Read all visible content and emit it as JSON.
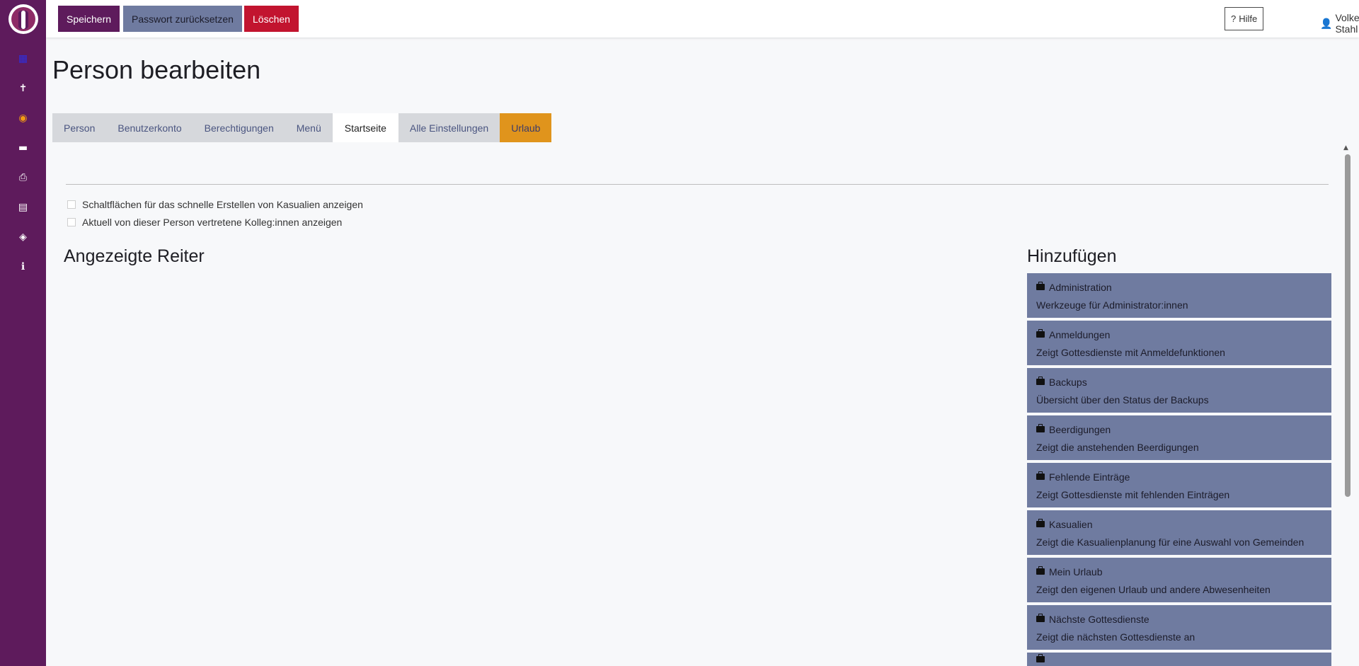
{
  "sidebar": {
    "icons": [
      {
        "name": "calendar-icon",
        "glyph": "▦"
      },
      {
        "name": "cross-icon",
        "glyph": "✝"
      },
      {
        "name": "globe-icon",
        "glyph": "◉"
      },
      {
        "name": "card-icon",
        "glyph": "▬"
      },
      {
        "name": "printer-icon",
        "glyph": "⎙"
      },
      {
        "name": "calendar-week-icon",
        "glyph": "▤"
      },
      {
        "name": "user-shield-icon",
        "glyph": "◈"
      },
      {
        "name": "info-icon",
        "glyph": "ℹ"
      }
    ]
  },
  "toolbar": {
    "save_label": "Speichern",
    "reset_password_label": "Passwort zurücksetzen",
    "delete_label": "Löschen",
    "help_label": "Hilfe",
    "user_name": "Volker Stahl"
  },
  "page": {
    "title": "Person bearbeiten"
  },
  "tabs": [
    {
      "label": "Person"
    },
    {
      "label": "Benutzerkonto"
    },
    {
      "label": "Berechtigungen"
    },
    {
      "label": "Menü"
    },
    {
      "label": "Startseite",
      "active": true
    },
    {
      "label": "Alle Einstellungen"
    },
    {
      "label": "Urlaub"
    }
  ],
  "options": {
    "quick_casualia": "Schaltflächen für das schnelle Erstellen von Kasualien anzeigen",
    "show_represented": "Aktuell von dieser Person vertretene Kolleg:innen anzeigen"
  },
  "sections": {
    "displayed_tabs_title": "Angezeigte Reiter",
    "add_title": "Hinzufügen"
  },
  "add_items": [
    {
      "title": "Administration",
      "desc": "Werkzeuge für Administrator:innen"
    },
    {
      "title": "Anmeldungen",
      "desc": "Zeigt Gottesdienste mit Anmeldefunktionen"
    },
    {
      "title": "Backups",
      "desc": "Übersicht über den Status der Backups"
    },
    {
      "title": "Beerdigungen",
      "desc": "Zeigt die anstehenden Beerdigungen"
    },
    {
      "title": "Fehlende Einträge",
      "desc": "Zeigt Gottesdienste mit fehlenden Einträgen"
    },
    {
      "title": "Kasualien",
      "desc": "Zeigt die Kasualienplanung für eine Auswahl von Gemeinden"
    },
    {
      "title": "Mein Urlaub",
      "desc": "Zeigt den eigenen Urlaub und andere Abwesenheiten"
    },
    {
      "title": "Nächste Gottesdienste",
      "desc": "Zeigt die nächsten Gottesdienste an"
    }
  ],
  "colors": {
    "sidebar": "#5e1b5c",
    "primary": "#5e1b5c",
    "secondary": "#6f7ba0",
    "danger": "#c2142f",
    "warning": "#e0941c"
  }
}
